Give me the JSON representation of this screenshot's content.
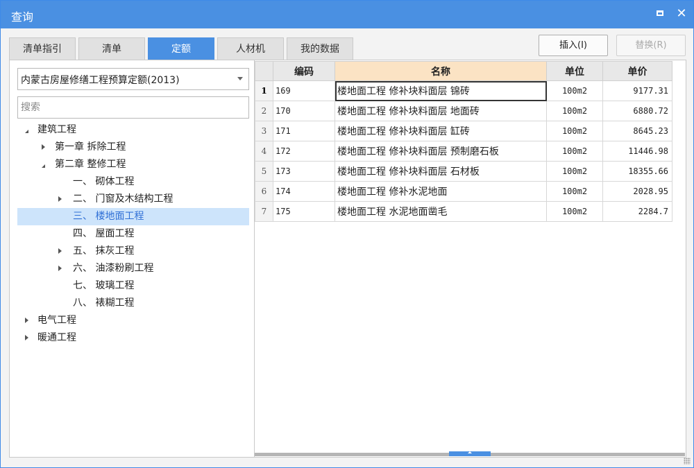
{
  "window": {
    "title": "查询"
  },
  "tabs": [
    {
      "label": "清单指引",
      "active": false
    },
    {
      "label": "清单",
      "active": false
    },
    {
      "label": "定额",
      "active": true
    },
    {
      "label": "人材机",
      "active": false
    },
    {
      "label": "我的数据",
      "active": false
    }
  ],
  "toolbar": {
    "insert_label": "插入(I)",
    "replace_label": "替换(R)"
  },
  "left": {
    "dropdown_value": "内蒙古房屋修缮工程预算定额(2013)",
    "search_placeholder": "搜索",
    "tree": [
      {
        "label": "建筑工程",
        "level": 0,
        "toggle": "expanded"
      },
      {
        "label": "第一章 拆除工程",
        "level": 1,
        "toggle": "collapsed"
      },
      {
        "label": "第二章 整修工程",
        "level": 1,
        "toggle": "expanded"
      },
      {
        "label": "一、 砌体工程",
        "level": 2,
        "toggle": "none"
      },
      {
        "label": "二、 门窗及木结构工程",
        "level": 2,
        "toggle": "collapsed"
      },
      {
        "label": "三、 楼地面工程",
        "level": 2,
        "toggle": "none",
        "selected": true
      },
      {
        "label": "四、 屋面工程",
        "level": 2,
        "toggle": "none"
      },
      {
        "label": "五、 抹灰工程",
        "level": 2,
        "toggle": "collapsed"
      },
      {
        "label": "六、 油漆粉刷工程",
        "level": 2,
        "toggle": "collapsed"
      },
      {
        "label": "七、 玻璃工程",
        "level": 2,
        "toggle": "none"
      },
      {
        "label": "八、 裱糊工程",
        "level": 2,
        "toggle": "none"
      },
      {
        "label": "电气工程",
        "level": 0,
        "toggle": "collapsed"
      },
      {
        "label": "暖通工程",
        "level": 0,
        "toggle": "collapsed"
      }
    ]
  },
  "grid": {
    "headers": {
      "code": "编码",
      "name": "名称",
      "unit": "单位",
      "price": "单价"
    },
    "rows": [
      {
        "n": "1",
        "code": "169",
        "name": "楼地面工程 修补块料面层 锦砖",
        "unit": "100m2",
        "price": "9177.31"
      },
      {
        "n": "2",
        "code": "170",
        "name": "楼地面工程 修补块料面层 地面砖",
        "unit": "100m2",
        "price": "6880.72"
      },
      {
        "n": "3",
        "code": "171",
        "name": "楼地面工程 修补块料面层 缸砖",
        "unit": "100m2",
        "price": "8645.23"
      },
      {
        "n": "4",
        "code": "172",
        "name": "楼地面工程 修补块料面层 预制磨石板",
        "unit": "100m2",
        "price": "11446.98"
      },
      {
        "n": "5",
        "code": "173",
        "name": "楼地面工程 修补块料面层 石材板",
        "unit": "100m2",
        "price": "18355.66"
      },
      {
        "n": "6",
        "code": "174",
        "name": "楼地面工程 修补水泥地面",
        "unit": "100m2",
        "price": "2028.95"
      },
      {
        "n": "7",
        "code": "175",
        "name": "楼地面工程 水泥地面凿毛",
        "unit": "100m2",
        "price": "2284.7"
      }
    ]
  },
  "colors": {
    "accent": "#4a90e2",
    "selected_bg": "#cde4fb",
    "active_header": "#fbe3c4"
  }
}
